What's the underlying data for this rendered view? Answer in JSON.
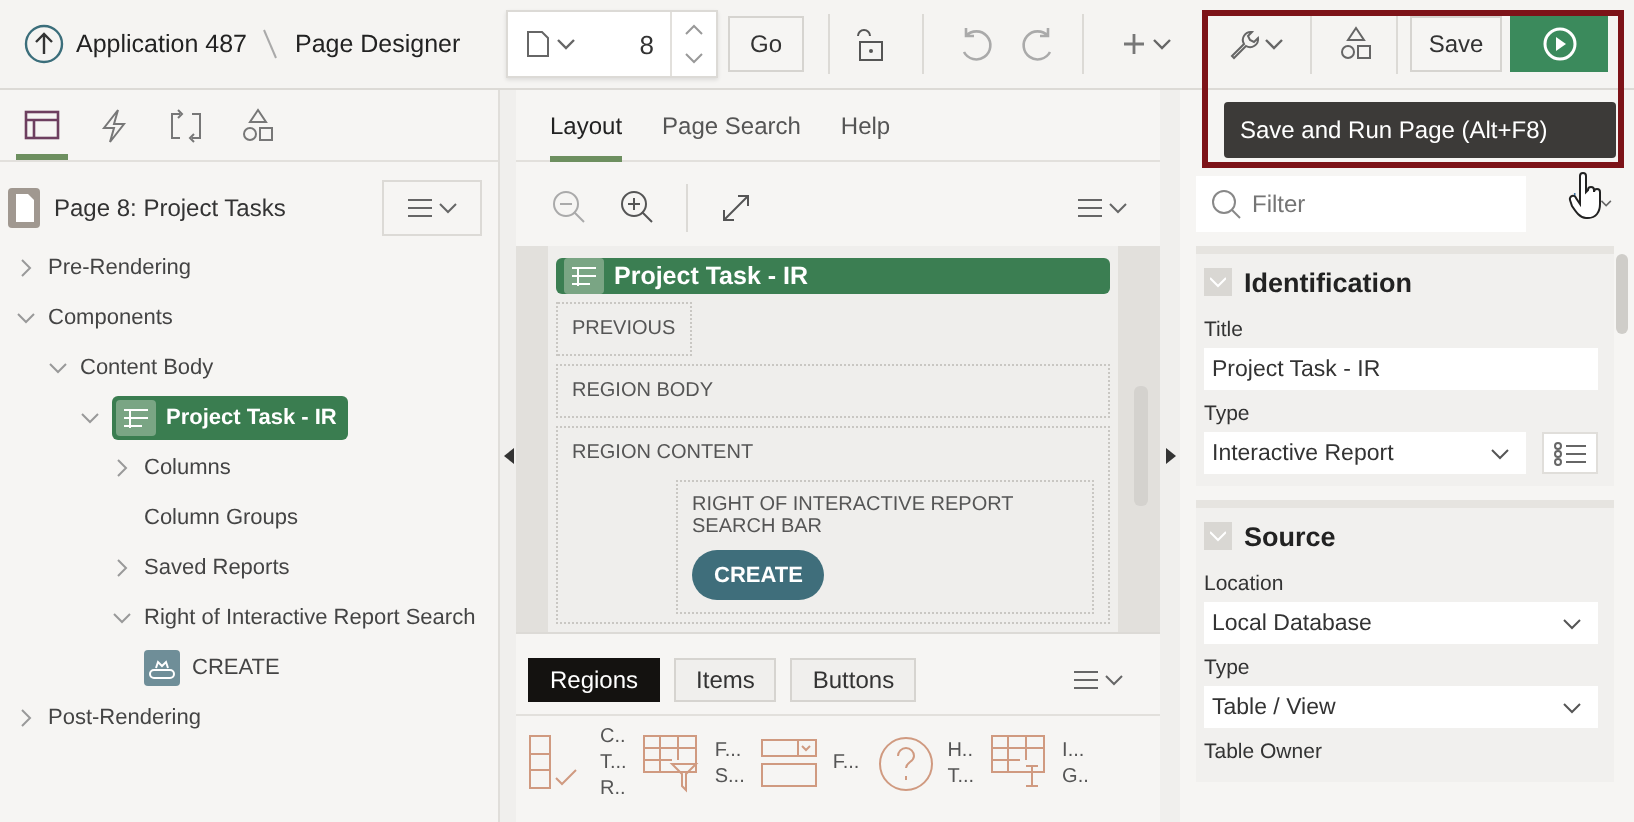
{
  "header": {
    "app": "Application 487",
    "title": "Page Designer",
    "page_number": "8",
    "go": "Go",
    "save": "Save"
  },
  "run_tooltip": "Save and Run Page (Alt+F8)",
  "left_tabs": [
    {
      "kind": "rendering",
      "selected": true
    },
    {
      "kind": "dynamic",
      "selected": false
    },
    {
      "kind": "processing",
      "selected": false
    },
    {
      "kind": "shared",
      "selected": false
    }
  ],
  "tree": {
    "title": "Page 8: Project Tasks",
    "nodes": [
      {
        "label": "Pre-Rendering",
        "kind": "folder",
        "expanded": false,
        "selected": false
      },
      {
        "label": "Components",
        "kind": "folder",
        "expanded": true,
        "selected": false,
        "children": [
          {
            "label": "Content Body",
            "kind": "folder",
            "expanded": true,
            "selected": false,
            "children": [
              {
                "label": "Project Task - IR",
                "kind": "region",
                "expanded": true,
                "selected": true,
                "children": [
                  {
                    "label": "Columns",
                    "kind": "folder",
                    "expanded": false,
                    "selected": false
                  },
                  {
                    "label": "Column Groups",
                    "kind": "leaf",
                    "selected": false
                  },
                  {
                    "label": "Saved Reports",
                    "kind": "folder",
                    "expanded": false,
                    "selected": false
                  },
                  {
                    "label": "Right of Interactive Report Search",
                    "kind": "folder",
                    "expanded": true,
                    "selected": false,
                    "children": [
                      {
                        "label": "CREATE",
                        "kind": "button",
                        "selected": false
                      }
                    ]
                  }
                ]
              }
            ]
          }
        ]
      },
      {
        "label": "Post-Rendering",
        "kind": "folder",
        "expanded": false,
        "selected": false
      }
    ]
  },
  "center_tabs": [
    {
      "label": "Layout",
      "selected": true
    },
    {
      "label": "Page Search",
      "selected": false
    },
    {
      "label": "Help",
      "selected": false
    }
  ],
  "layout": {
    "region_title": "Project Task - IR",
    "slots": [
      "PREVIOUS",
      "REGION BODY"
    ],
    "content": {
      "label": "REGION CONTENT",
      "sub_label": "RIGHT OF INTERACTIVE REPORT SEARCH BAR",
      "button": "CREATE"
    }
  },
  "gallery": {
    "tabs": [
      {
        "label": "Regions",
        "selected": true
      },
      {
        "label": "Items",
        "selected": false
      },
      {
        "label": "Buttons",
        "selected": false
      }
    ],
    "items": [
      {
        "kind": "checklist",
        "lines": [
          "C..",
          "T...",
          "R.."
        ]
      },
      {
        "kind": "filter",
        "lines": [
          "F...",
          "S..."
        ]
      },
      {
        "kind": "form",
        "lines": [
          "F..."
        ]
      },
      {
        "kind": "help",
        "lines": [
          "H..",
          "T..."
        ]
      },
      {
        "kind": "grid",
        "lines": [
          "I...",
          "G.."
        ]
      }
    ]
  },
  "properties": {
    "filter_placeholder": "Filter",
    "sections": [
      {
        "title": "Identification",
        "expanded": true,
        "fields": [
          {
            "label": "Title",
            "kind": "text",
            "value": "Project Task - IR"
          },
          {
            "label": "Type",
            "kind": "select_list",
            "value": "Interactive Report"
          }
        ]
      },
      {
        "title": "Source",
        "expanded": true,
        "fields": [
          {
            "label": "Location",
            "kind": "select",
            "value": "Local Database"
          },
          {
            "label": "Type",
            "kind": "select",
            "value": "Table / View"
          },
          {
            "label": "Table Owner",
            "kind": "cut"
          }
        ]
      }
    ]
  }
}
